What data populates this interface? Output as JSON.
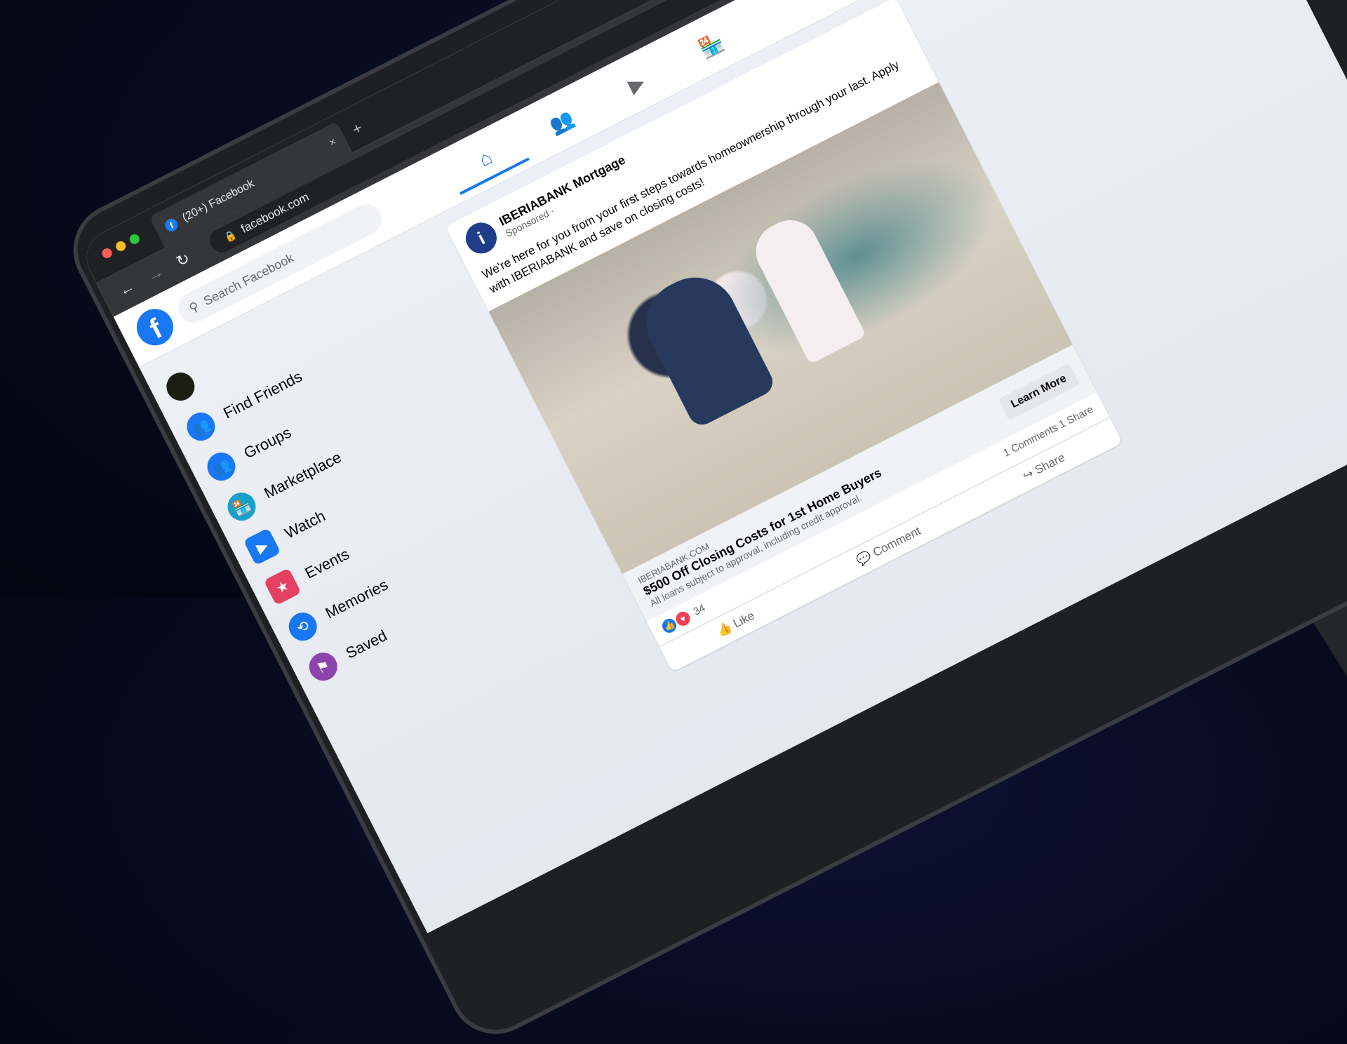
{
  "browser": {
    "tab_title": "(20+) Facebook",
    "tab_favicon": "f",
    "tab_close": "×",
    "new_tab": "+",
    "url": "facebook.com",
    "back": "←",
    "forward": "→",
    "reload": "↻",
    "lock": "🔒"
  },
  "header": {
    "logo": "f",
    "search_placeholder": "Search Facebook",
    "search_icon": "search-icon",
    "nav_tabs": [
      {
        "icon": "home-icon",
        "glyph": "⌂",
        "active": true
      },
      {
        "icon": "friends-icon",
        "glyph": "👥",
        "active": false
      },
      {
        "icon": "watch-icon",
        "glyph": "▶",
        "active": false
      },
      {
        "icon": "marketplace-icon",
        "glyph": "🏪",
        "active": false
      }
    ],
    "more": "···"
  },
  "sidebar": {
    "items": [
      {
        "label": "",
        "icon": "avatar",
        "glyph": ""
      },
      {
        "label": "Find Friends",
        "icon": "find-friends-icon",
        "glyph": "👥"
      },
      {
        "label": "Groups",
        "icon": "groups-icon",
        "glyph": "👥"
      },
      {
        "label": "Marketplace",
        "icon": "marketplace-icon",
        "glyph": "🏪"
      },
      {
        "label": "Watch",
        "icon": "watch-icon",
        "glyph": "▶"
      },
      {
        "label": "Events",
        "icon": "events-icon",
        "glyph": "★"
      },
      {
        "label": "Memories",
        "icon": "memories-icon",
        "glyph": "⟲"
      },
      {
        "label": "Saved",
        "icon": "saved-icon",
        "glyph": "⚑"
      }
    ]
  },
  "post": {
    "page_name": "IBERIABANK Mortgage",
    "page_logo": "i",
    "sponsored": "Sponsored ·",
    "text": "We're here for you from your first steps towards homeownership through your last. Apply with IBERIABANK and save on closing costs!",
    "ad": {
      "domain": "IBERIABANK.COM",
      "title": "$500 Off Closing Costs for 1st Home Buyers",
      "subtitle": "All loans subject to approval, including credit approval.",
      "cta": "Learn More"
    },
    "reaction_count": "34",
    "comments_shares": "1 Comments 1 Share",
    "actions": {
      "like": "Like",
      "comment": "Comment",
      "share": "Share"
    }
  },
  "colors": {
    "brand": "#1877f2",
    "love": "#f33e58"
  }
}
